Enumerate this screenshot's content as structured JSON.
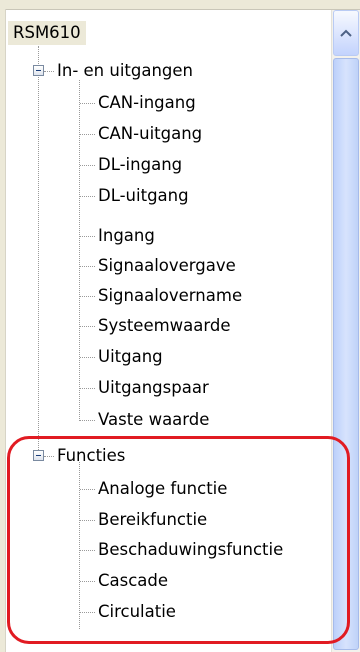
{
  "tree": {
    "root": "RSM610",
    "groups": [
      {
        "label": "In- en uitgangen",
        "expanded": true,
        "items": [
          "CAN-ingang",
          "CAN-uitgang",
          "DL-ingang",
          "DL-uitgang",
          "Ingang",
          "Signaalovergave",
          "Signaalovername",
          "Systeemwaarde",
          "Uitgang",
          "Uitgangspaar",
          "Vaste waarde"
        ]
      },
      {
        "label": "Functies",
        "expanded": true,
        "items": [
          "Analoge functie",
          "Bereikfunctie",
          "Beschaduwingsfunctie",
          "Cascade",
          "Circulatie"
        ]
      }
    ]
  },
  "scrollbar": {
    "up_icon": "chevron-up-icon"
  },
  "annotation": {
    "color": "#e11b22"
  }
}
